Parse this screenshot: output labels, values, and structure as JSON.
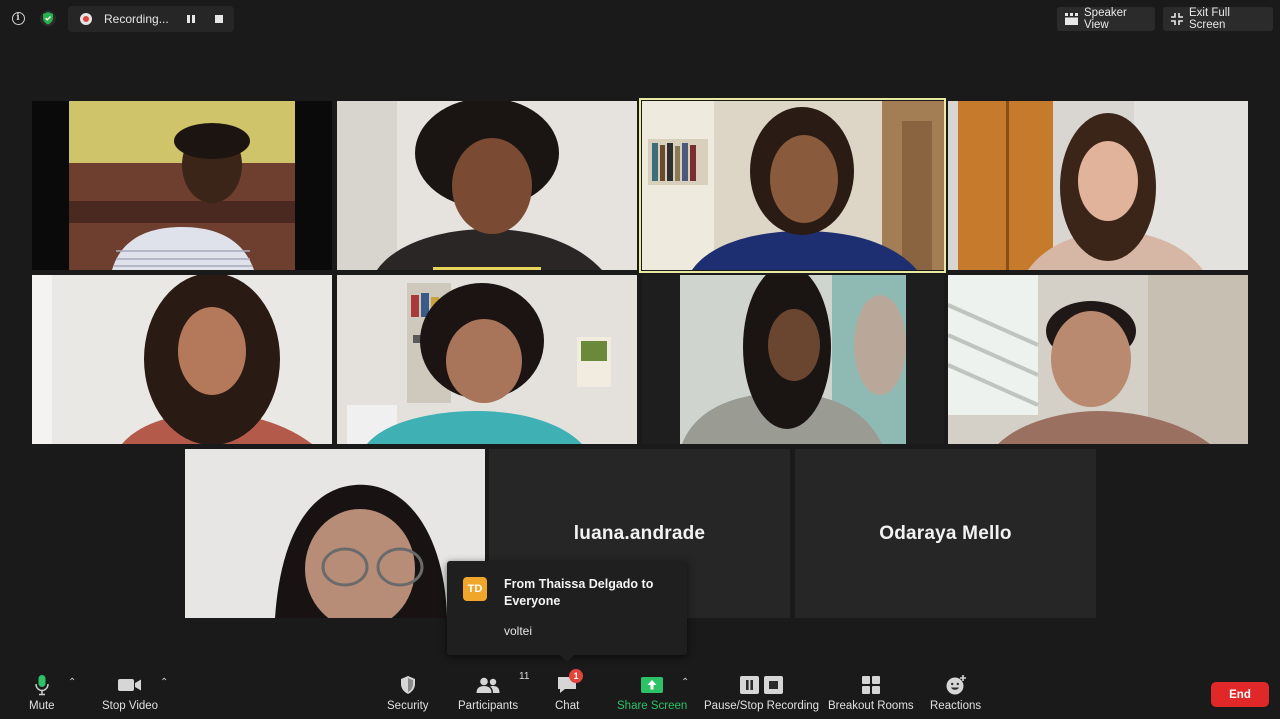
{
  "topbar": {
    "recording_label": "Recording...",
    "speaker_view_label": "Speaker View",
    "exit_fullscreen_label": "Exit Full Screen"
  },
  "participants_grid": {
    "name_tiles": [
      "luana.andrade",
      "Odaraya Mello"
    ],
    "active_speaker_border_color": "#e9e9a0"
  },
  "chat_popup": {
    "avatar_initials": "TD",
    "from": "From Thaissa Delgado to Everyone",
    "message": "voltei"
  },
  "toolbar": {
    "mute_label": "Mute",
    "stop_video_label": "Stop Video",
    "security_label": "Security",
    "participants_label": "Participants",
    "participants_count": "11",
    "chat_label": "Chat",
    "chat_unread": "1",
    "share_screen_label": "Share Screen",
    "recording_label": "Pause/Stop Recording",
    "breakout_label": "Breakout Rooms",
    "reactions_label": "Reactions",
    "end_label": "End"
  },
  "colors": {
    "background": "#1a1a1a",
    "share_green": "#2dc268",
    "end_red": "#e02828",
    "badge_red": "#e0453a",
    "avatar_orange": "#f0a52b"
  }
}
